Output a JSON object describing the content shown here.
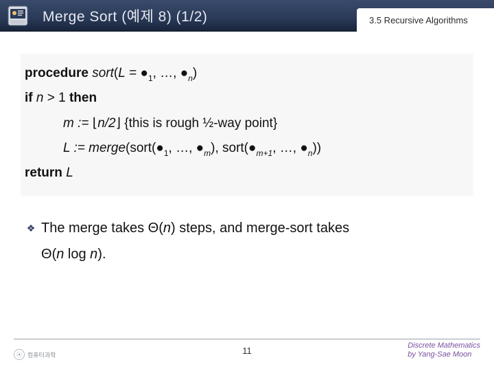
{
  "header": {
    "title": "Merge Sort (예제 8) (1/2)",
    "section_label": "3.5 Recursive Algorithms"
  },
  "code": {
    "line1": {
      "kw1": "procedure",
      "fn": "sort",
      "open": "(",
      "var": "L",
      "eq": " = ",
      "bullet": "●",
      "sub1": "1",
      "sep": ", …, ",
      "subn": "n",
      "close": ")"
    },
    "line2": {
      "kw_if": "if",
      "var": "n",
      "cmp": " > 1 ",
      "kw_then": "then"
    },
    "line3": {
      "lhs": "m := ",
      "floorL": "⌊",
      "expr": "n/2",
      "floorR": "⌋",
      "comment": "   {this is rough ½-way point}"
    },
    "line4": {
      "lhs": "L := ",
      "fn1": "merge",
      "p1": "(sort(",
      "b": "●",
      "s1": "1",
      "sep1": ", …, ",
      "sm": "m",
      "mid": "), sort(",
      "smp1": "m+1",
      "sep2": ", …, ",
      "sn": "n",
      "end": "))"
    },
    "line5": {
      "kw": "return",
      "var": "L"
    }
  },
  "body": {
    "bullet_glyph": "❖",
    "text1_a": "The merge takes ",
    "text1_b": "Θ",
    "text1_c": "(",
    "text1_d": "n",
    "text1_e": ") steps, and merge-sort takes",
    "text2_a": "Θ",
    "text2_b": "(",
    "text2_c": "n",
    "text2_d": " log ",
    "text2_e": "n",
    "text2_f": ")."
  },
  "footer": {
    "page": "11",
    "credit1": "Discrete Mathematics",
    "credit2": "by Yang-Sae Moon",
    "logo_text": "컴퓨터과학"
  }
}
